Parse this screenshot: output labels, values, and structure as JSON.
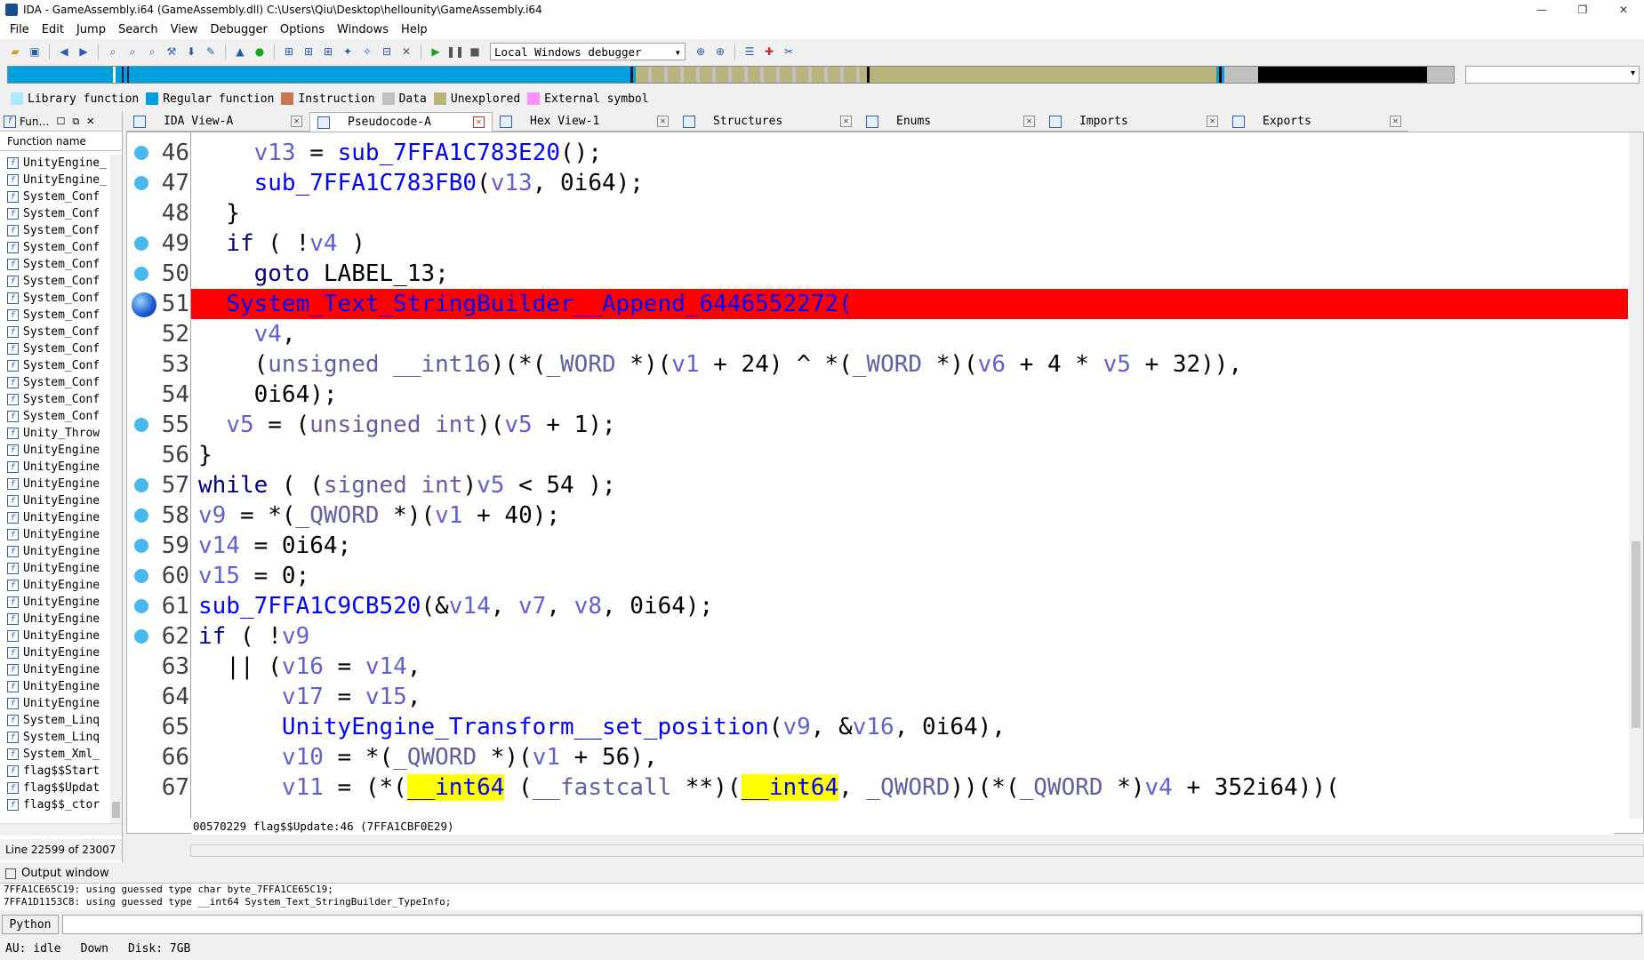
{
  "window": {
    "title": "IDA - GameAssembly.i64 (GameAssembly.dll) C:\\Users\\Qiu\\Desktop\\hellounity\\GameAssembly.i64",
    "minimize": "—",
    "maximize": "❐",
    "close": "✕"
  },
  "menu": [
    "File",
    "Edit",
    "Jump",
    "Search",
    "View",
    "Debugger",
    "Options",
    "Windows",
    "Help"
  ],
  "toolbar": {
    "debugger_select": "Local Windows debugger"
  },
  "legend": [
    {
      "label": "Library function",
      "color": "#aee8ff"
    },
    {
      "label": "Regular function",
      "color": "#00a0e0"
    },
    {
      "label": "Instruction",
      "color": "#c87850"
    },
    {
      "label": "Data",
      "color": "#c0c0c0"
    },
    {
      "label": "Unexplored",
      "color": "#b8b47c"
    },
    {
      "label": "External symbol",
      "color": "#ff90ff"
    }
  ],
  "tabs": [
    {
      "label": "IDA View-A",
      "active": false
    },
    {
      "label": "Pseudocode-A",
      "active": true
    },
    {
      "label": "Hex View-1",
      "active": false
    },
    {
      "label": "Structures",
      "active": false
    },
    {
      "label": "Enums",
      "active": false
    },
    {
      "label": "Imports",
      "active": false
    },
    {
      "label": "Exports",
      "active": false
    }
  ],
  "functions_panel": {
    "title": "Fun…",
    "column": "Function name",
    "items": [
      "UnityEngine_",
      "UnityEngine_",
      "System_Conf",
      "System_Conf",
      "System_Conf",
      "System_Conf",
      "System_Conf",
      "System_Conf",
      "System_Conf",
      "System_Conf",
      "System_Conf",
      "System_Conf",
      "System_Conf",
      "System_Conf",
      "System_Conf",
      "System_Conf",
      "Unity_Throw",
      "UnityEngine",
      "UnityEngine",
      "UnityEngine",
      "UnityEngine",
      "UnityEngine",
      "UnityEngine",
      "UnityEngine",
      "UnityEngine",
      "UnityEngine",
      "UnityEngine",
      "UnityEngine",
      "UnityEngine",
      "UnityEngine",
      "UnityEngine",
      "UnityEngine",
      "UnityEngine",
      "System_Linq",
      "System_Linq",
      "System_Xml_",
      "flag$$Start",
      "flag$$Updat",
      "flag$$_ctor"
    ],
    "status": "Line 22599 of 23007"
  },
  "code": {
    "lines": [
      {
        "n": "46",
        "bp": "small",
        "hl": false,
        "parts": [
          [
            "    ",
            ""
          ],
          [
            "v13",
            "var"
          ],
          [
            " = ",
            ""
          ],
          [
            "sub_7FFA1C783E20",
            "fn"
          ],
          [
            "();",
            ""
          ]
        ]
      },
      {
        "n": "47",
        "bp": "small",
        "hl": false,
        "parts": [
          [
            "    ",
            ""
          ],
          [
            "sub_7FFA1C783FB0",
            "fn"
          ],
          [
            "(",
            ""
          ],
          [
            "v13",
            "var"
          ],
          [
            ", 0i64);",
            ""
          ]
        ]
      },
      {
        "n": "48",
        "bp": "",
        "hl": false,
        "parts": [
          [
            "  }",
            ""
          ]
        ]
      },
      {
        "n": "49",
        "bp": "small",
        "hl": false,
        "parts": [
          [
            "  ",
            ""
          ],
          [
            "if",
            "kw"
          ],
          [
            " ( !",
            ""
          ],
          [
            "v4",
            "var"
          ],
          [
            " )",
            ""
          ]
        ]
      },
      {
        "n": "50",
        "bp": "small",
        "hl": false,
        "parts": [
          [
            "    ",
            ""
          ],
          [
            "goto",
            "kw"
          ],
          [
            " LABEL_13;",
            ""
          ]
        ]
      },
      {
        "n": "51",
        "bp": "big",
        "hl": true,
        "parts": [
          [
            "  ",
            ""
          ],
          [
            "System_Text_StringBuilder__Append_6446552272",
            "fn"
          ],
          [
            "(",
            "fn"
          ]
        ]
      },
      {
        "n": "52",
        "bp": "",
        "hl": false,
        "parts": [
          [
            "    ",
            ""
          ],
          [
            "v4",
            "var"
          ],
          [
            ",",
            ""
          ]
        ]
      },
      {
        "n": "53",
        "bp": "",
        "hl": false,
        "parts": [
          [
            "    (",
            ""
          ],
          [
            "unsigned __int16",
            "typ"
          ],
          [
            ")(*(",
            ""
          ],
          [
            "_WORD",
            "typ"
          ],
          [
            " *)(",
            ""
          ],
          [
            "v1",
            "var"
          ],
          [
            " + 24) ^ *(",
            ""
          ],
          [
            "_WORD",
            "typ"
          ],
          [
            " *)(",
            ""
          ],
          [
            "v6",
            "var"
          ],
          [
            " + 4 * ",
            ""
          ],
          [
            "v5",
            "var"
          ],
          [
            " + 32)),",
            ""
          ]
        ]
      },
      {
        "n": "54",
        "bp": "",
        "hl": false,
        "parts": [
          [
            "    0i64);",
            ""
          ]
        ]
      },
      {
        "n": "55",
        "bp": "small",
        "hl": false,
        "parts": [
          [
            "  ",
            ""
          ],
          [
            "v5",
            "var"
          ],
          [
            " = (",
            ""
          ],
          [
            "unsigned int",
            "typ"
          ],
          [
            ")(",
            ""
          ],
          [
            "v5",
            "var"
          ],
          [
            " + 1);",
            ""
          ]
        ]
      },
      {
        "n": "56",
        "bp": "",
        "hl": false,
        "parts": [
          [
            "}",
            ""
          ]
        ]
      },
      {
        "n": "57",
        "bp": "small",
        "hl": false,
        "parts": [
          [
            "while",
            "kw"
          ],
          [
            " ( (",
            ""
          ],
          [
            "signed int",
            "typ"
          ],
          [
            ")",
            ""
          ],
          [
            "v5",
            "var"
          ],
          [
            " < 54 );",
            ""
          ]
        ]
      },
      {
        "n": "58",
        "bp": "small",
        "hl": false,
        "parts": [
          [
            "v9",
            "var"
          ],
          [
            " = *(",
            ""
          ],
          [
            "_QWORD",
            "typ"
          ],
          [
            " *)(",
            ""
          ],
          [
            "v1",
            "var"
          ],
          [
            " + 40);",
            ""
          ]
        ]
      },
      {
        "n": "59",
        "bp": "small",
        "hl": false,
        "parts": [
          [
            "v14",
            "var"
          ],
          [
            " = 0i64;",
            ""
          ]
        ]
      },
      {
        "n": "60",
        "bp": "small",
        "hl": false,
        "parts": [
          [
            "v15",
            "var"
          ],
          [
            " = 0;",
            ""
          ]
        ]
      },
      {
        "n": "61",
        "bp": "small",
        "hl": false,
        "parts": [
          [
            "sub_7FFA1C9CB520",
            "fn"
          ],
          [
            "(&",
            ""
          ],
          [
            "v14",
            "var"
          ],
          [
            ", ",
            ""
          ],
          [
            "v7",
            "var"
          ],
          [
            ", ",
            ""
          ],
          [
            "v8",
            "var"
          ],
          [
            ", 0i64);",
            ""
          ]
        ]
      },
      {
        "n": "62",
        "bp": "small",
        "hl": false,
        "parts": [
          [
            "if",
            "kw"
          ],
          [
            " ( !",
            ""
          ],
          [
            "v9",
            "var"
          ]
        ]
      },
      {
        "n": "63",
        "bp": "",
        "hl": false,
        "parts": [
          [
            "  || (",
            ""
          ],
          [
            "v16",
            "var"
          ],
          [
            " = ",
            ""
          ],
          [
            "v14",
            "var"
          ],
          [
            ",",
            ""
          ]
        ]
      },
      {
        "n": "64",
        "bp": "",
        "hl": false,
        "parts": [
          [
            "      ",
            ""
          ],
          [
            "v17",
            "var"
          ],
          [
            " = ",
            ""
          ],
          [
            "v15",
            "var"
          ],
          [
            ",",
            ""
          ]
        ]
      },
      {
        "n": "65",
        "bp": "",
        "hl": false,
        "parts": [
          [
            "      ",
            ""
          ],
          [
            "UnityEngine_Transform__set_position",
            "fn"
          ],
          [
            "(",
            ""
          ],
          [
            "v9",
            "var"
          ],
          [
            ", &",
            ""
          ],
          [
            "v16",
            "var"
          ],
          [
            ", 0i64),",
            ""
          ]
        ]
      },
      {
        "n": "66",
        "bp": "",
        "hl": false,
        "parts": [
          [
            "      ",
            ""
          ],
          [
            "v10",
            "var"
          ],
          [
            " = *(",
            ""
          ],
          [
            "_QWORD",
            "typ"
          ],
          [
            " *)(",
            ""
          ],
          [
            "v1",
            "var"
          ],
          [
            " + 56),",
            ""
          ]
        ]
      },
      {
        "n": "67",
        "bp": "",
        "hl": false,
        "parts": [
          [
            "      ",
            ""
          ],
          [
            "v11",
            "var"
          ],
          [
            " = (*(",
            ""
          ],
          [
            "__int64",
            "yel"
          ],
          [
            " (",
            ""
          ],
          [
            "__fastcall",
            "typ"
          ],
          [
            " **)(",
            ""
          ],
          [
            "__int64",
            "yel"
          ],
          [
            ", ",
            ""
          ],
          [
            "_QWORD",
            "typ"
          ],
          [
            "))(*(",
            ""
          ],
          [
            "_QWORD",
            "typ"
          ],
          [
            " *)",
            ""
          ],
          [
            "v4",
            "var"
          ],
          [
            " + 352i64))(",
            ""
          ]
        ]
      }
    ],
    "status": "00570229 flag$$Update:46 (7FFA1CBF0E29)"
  },
  "output": {
    "title": "Output window",
    "lines": [
      "7FFA1CE65C19: using guessed type char byte_7FFA1CE65C19;",
      "7FFA1D1153C8: using guessed type __int64 System_Text_StringBuilder_TypeInfo;"
    ],
    "python_label": "Python"
  },
  "statusbar": {
    "au": "AU:  idle",
    "dir": "Down",
    "disk": "Disk: 7GB"
  }
}
